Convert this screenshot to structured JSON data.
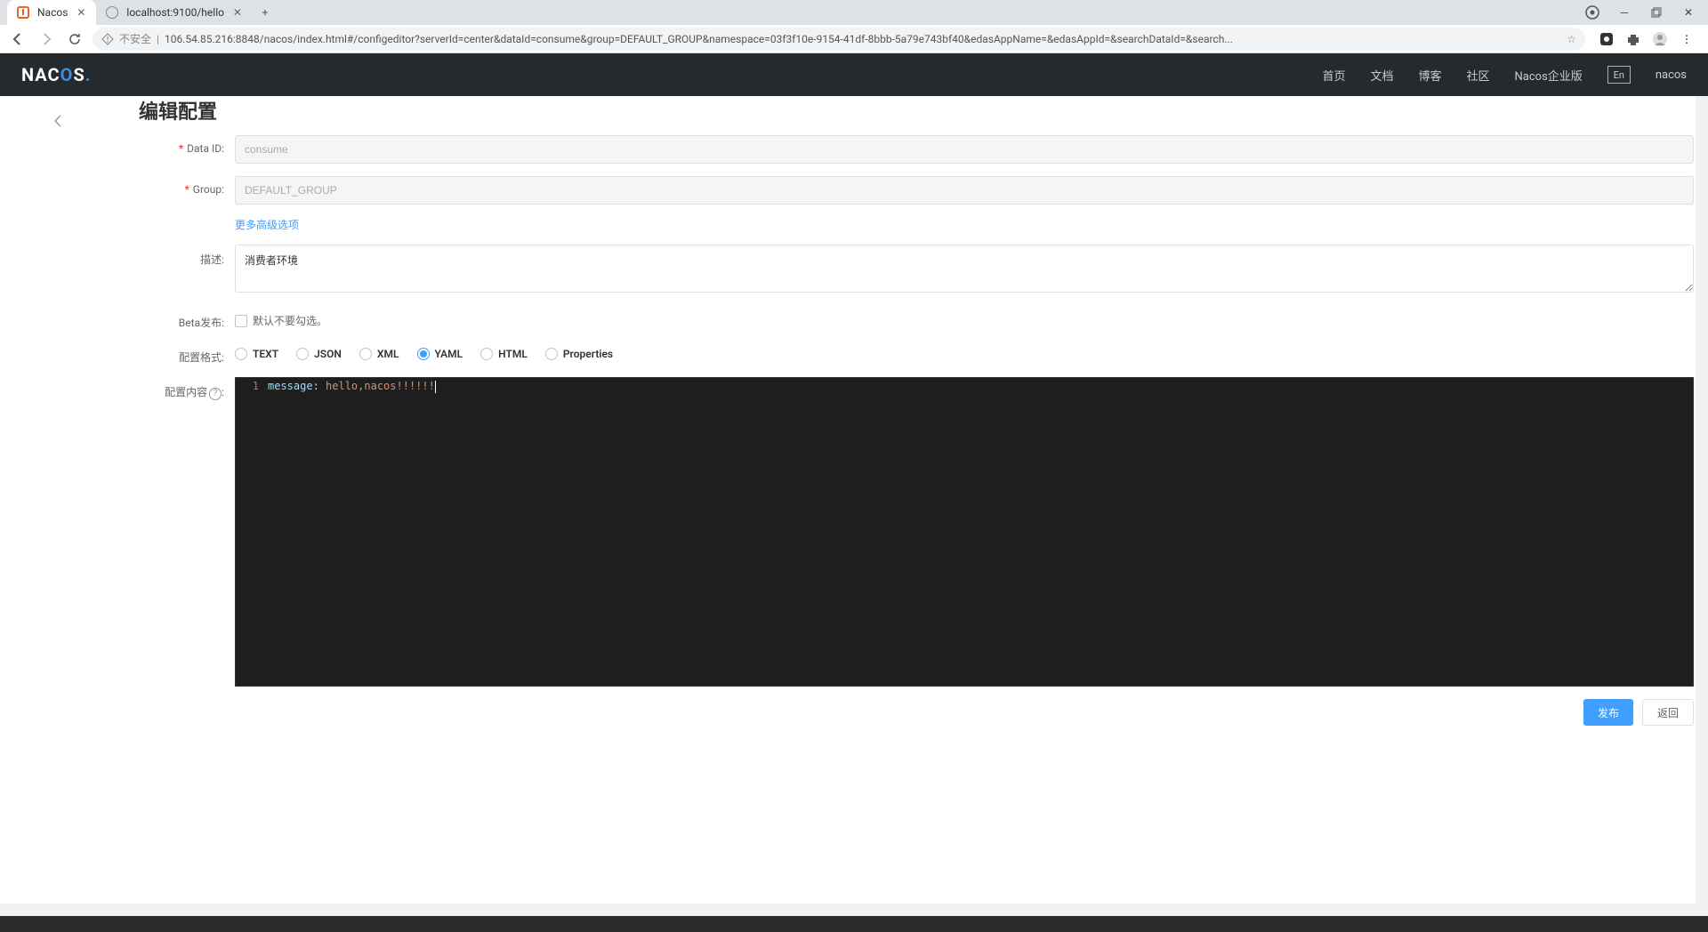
{
  "browser": {
    "tabs": [
      {
        "title": "Nacos",
        "active": true
      },
      {
        "title": "localhost:9100/hello",
        "active": false
      }
    ],
    "security_label": "不安全",
    "url": "106.54.85.216:8848/nacos/index.html#/configeditor?serverId=center&dataId=consume&group=DEFAULT_GROUP&namespace=03f3f10e-9154-41df-8bbb-5a79e743bf40&edasAppName=&edasAppId=&searchDataId=&search..."
  },
  "header": {
    "logo": "NACOS.",
    "nav": {
      "home": "首页",
      "docs": "文档",
      "blog": "博客",
      "community": "社区",
      "enterprise": "Nacos企业版"
    },
    "lang": "En",
    "username": "nacos"
  },
  "page": {
    "title": "编辑配置",
    "labels": {
      "data_id": "Data ID:",
      "group": "Group:",
      "advanced": "更多高级选项",
      "description": "描述:",
      "beta": "Beta发布:",
      "beta_hint": "默认不要勾选。",
      "format": "配置格式:",
      "content": "配置内容",
      "help": "?"
    },
    "values": {
      "data_id": "consume",
      "group": "DEFAULT_GROUP",
      "description": "消费者环境"
    },
    "formats": {
      "text": "TEXT",
      "json": "JSON",
      "xml": "XML",
      "yaml": "YAML",
      "html": "HTML",
      "properties": "Properties"
    },
    "selected_format": "YAML",
    "code": {
      "line_no": "1",
      "key": "message",
      "punct": ": ",
      "value": "hello,nacos!!!!!!"
    },
    "buttons": {
      "publish": "发布",
      "back": "返回"
    }
  }
}
